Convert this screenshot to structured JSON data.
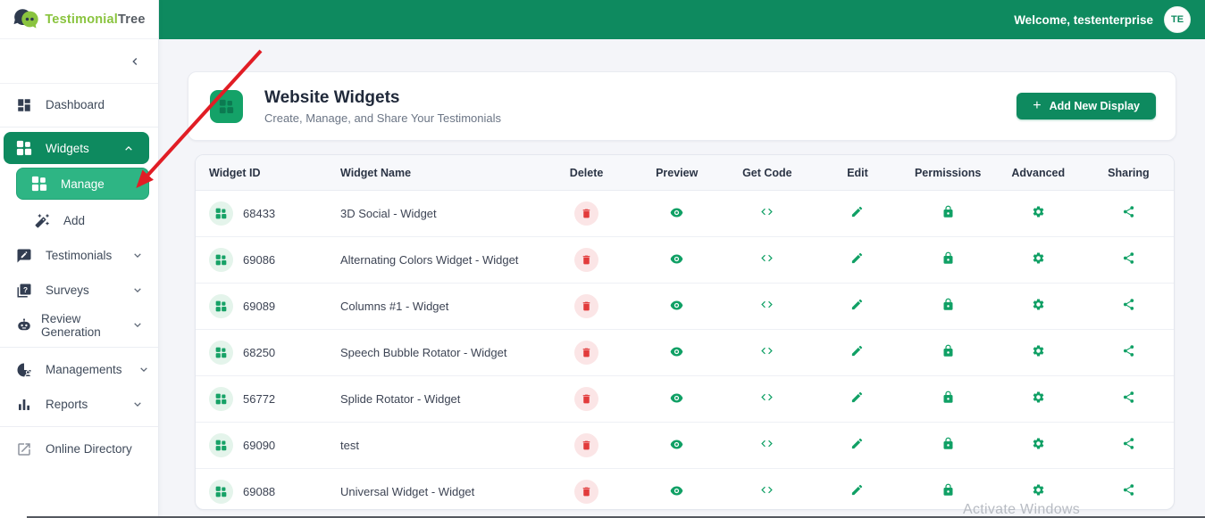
{
  "brand": {
    "logo_primary": "Testimonial",
    "logo_secondary": "Tree"
  },
  "topbar": {
    "welcome_text": "Welcome, testenterprise",
    "avatar_initials": "TE"
  },
  "sidebar": {
    "items": [
      {
        "label": "Dashboard"
      },
      {
        "label": "Widgets"
      },
      {
        "label": "Manage"
      },
      {
        "label": "Add"
      },
      {
        "label": "Testimonials"
      },
      {
        "label": "Surveys"
      },
      {
        "label": "Review Generation"
      },
      {
        "label": "Managements"
      },
      {
        "label": "Reports"
      },
      {
        "label": "Online Directory"
      }
    ]
  },
  "page_header": {
    "title": "Website Widgets",
    "subtitle": "Create, Manage, and Share Your Testimonials",
    "add_button_plus": "+",
    "add_button_label": "Add New Display"
  },
  "table": {
    "columns": [
      "Widget ID",
      "Widget Name",
      "Delete",
      "Preview",
      "Get Code",
      "Edit",
      "Permissions",
      "Advanced",
      "Sharing"
    ],
    "rows": [
      {
        "id": "68433",
        "name": "3D Social - Widget"
      },
      {
        "id": "69086",
        "name": "Alternating Colors Widget - Widget"
      },
      {
        "id": "69089",
        "name": "Columns #1 - Widget"
      },
      {
        "id": "68250",
        "name": "Speech Bubble Rotator - Widget"
      },
      {
        "id": "56772",
        "name": "Splide Rotator - Widget"
      },
      {
        "id": "69090",
        "name": "test"
      },
      {
        "id": "69088",
        "name": "Universal Widget - Widget"
      }
    ]
  },
  "watermark": "Activate Windows",
  "colors": {
    "topbar_green": "#0e8a5f",
    "subitem_green": "#2eb584",
    "action_green": "#10a065",
    "delete_red": "#e23b3b",
    "arrow_red": "#e11d25",
    "logo_green": "#8ac43f"
  }
}
